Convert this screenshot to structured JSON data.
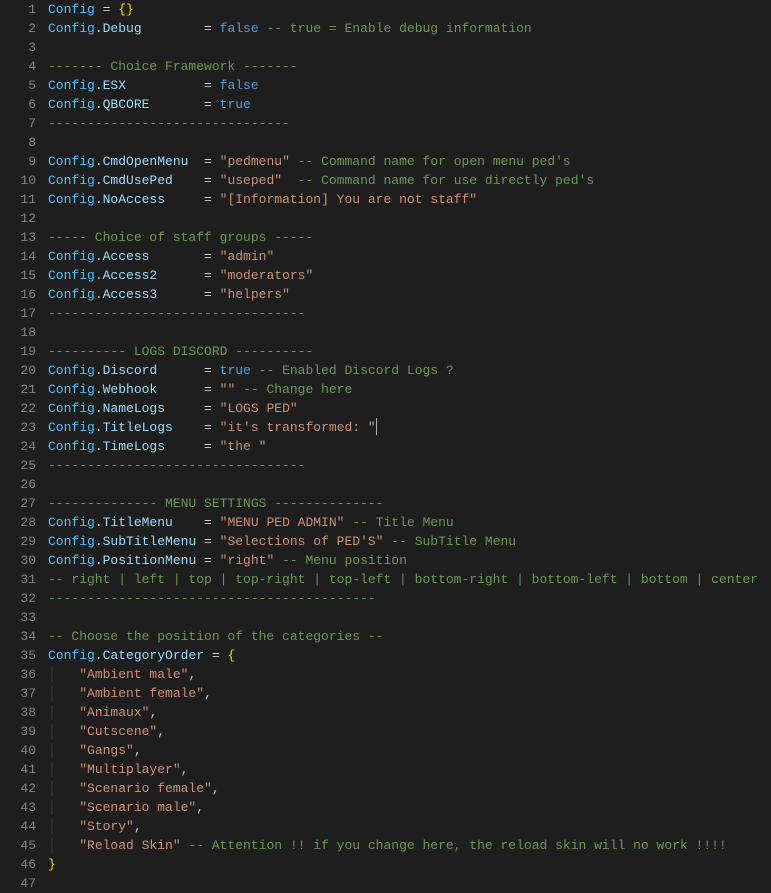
{
  "lines": [
    {
      "n": 1,
      "segs": [
        {
          "t": "Config",
          "c": "tok-obj"
        },
        {
          "t": " = ",
          "c": "tok-op"
        },
        {
          "t": "{}",
          "c": "tok-brace"
        }
      ]
    },
    {
      "n": 2,
      "segs": [
        {
          "t": "Config",
          "c": "tok-obj"
        },
        {
          "t": ".",
          "c": "tok-punc"
        },
        {
          "t": "Debug",
          "c": "tok-prop"
        },
        {
          "t": "        = ",
          "c": "tok-op"
        },
        {
          "t": "false",
          "c": "tok-bool"
        },
        {
          "t": " -- true = Enable debug information",
          "c": "tok-comment"
        }
      ]
    },
    {
      "n": 3,
      "segs": []
    },
    {
      "n": 4,
      "segs": [
        {
          "t": "------- Choice Framework -------",
          "c": "tok-comment"
        }
      ]
    },
    {
      "n": 5,
      "segs": [
        {
          "t": "Config",
          "c": "tok-obj"
        },
        {
          "t": ".",
          "c": "tok-punc"
        },
        {
          "t": "ESX",
          "c": "tok-prop"
        },
        {
          "t": "          = ",
          "c": "tok-op"
        },
        {
          "t": "false",
          "c": "tok-bool"
        }
      ]
    },
    {
      "n": 6,
      "segs": [
        {
          "t": "Config",
          "c": "tok-obj"
        },
        {
          "t": ".",
          "c": "tok-punc"
        },
        {
          "t": "QBCORE",
          "c": "tok-prop"
        },
        {
          "t": "       = ",
          "c": "tok-op"
        },
        {
          "t": "true",
          "c": "tok-bool"
        }
      ]
    },
    {
      "n": 7,
      "segs": [
        {
          "t": "-------------------------------",
          "c": "tok-comment"
        }
      ]
    },
    {
      "n": 8,
      "segs": []
    },
    {
      "n": 9,
      "segs": [
        {
          "t": "Config",
          "c": "tok-obj"
        },
        {
          "t": ".",
          "c": "tok-punc"
        },
        {
          "t": "CmdOpenMenu",
          "c": "tok-prop"
        },
        {
          "t": "  = ",
          "c": "tok-op"
        },
        {
          "t": "\"pedmenu\"",
          "c": "tok-str"
        },
        {
          "t": " -- Command name for open menu ped's",
          "c": "tok-comment"
        }
      ]
    },
    {
      "n": 10,
      "segs": [
        {
          "t": "Config",
          "c": "tok-obj"
        },
        {
          "t": ".",
          "c": "tok-punc"
        },
        {
          "t": "CmdUsePed",
          "c": "tok-prop"
        },
        {
          "t": "    = ",
          "c": "tok-op"
        },
        {
          "t": "\"useped\"",
          "c": "tok-str"
        },
        {
          "t": "  -- Command name for use directly ped's",
          "c": "tok-comment"
        }
      ]
    },
    {
      "n": 11,
      "segs": [
        {
          "t": "Config",
          "c": "tok-obj"
        },
        {
          "t": ".",
          "c": "tok-punc"
        },
        {
          "t": "NoAccess",
          "c": "tok-prop"
        },
        {
          "t": "     = ",
          "c": "tok-op"
        },
        {
          "t": "\"[Information] You are not staff\"",
          "c": "tok-str"
        }
      ]
    },
    {
      "n": 12,
      "segs": []
    },
    {
      "n": 13,
      "segs": [
        {
          "t": "----- Choice of staff groups -----",
          "c": "tok-comment"
        }
      ]
    },
    {
      "n": 14,
      "segs": [
        {
          "t": "Config",
          "c": "tok-obj"
        },
        {
          "t": ".",
          "c": "tok-punc"
        },
        {
          "t": "Access",
          "c": "tok-prop"
        },
        {
          "t": "       = ",
          "c": "tok-op"
        },
        {
          "t": "\"admin\"",
          "c": "tok-str"
        }
      ]
    },
    {
      "n": 15,
      "segs": [
        {
          "t": "Config",
          "c": "tok-obj"
        },
        {
          "t": ".",
          "c": "tok-punc"
        },
        {
          "t": "Access2",
          "c": "tok-prop"
        },
        {
          "t": "      = ",
          "c": "tok-op"
        },
        {
          "t": "\"moderators\"",
          "c": "tok-str"
        }
      ]
    },
    {
      "n": 16,
      "segs": [
        {
          "t": "Config",
          "c": "tok-obj"
        },
        {
          "t": ".",
          "c": "tok-punc"
        },
        {
          "t": "Access3",
          "c": "tok-prop"
        },
        {
          "t": "      = ",
          "c": "tok-op"
        },
        {
          "t": "\"helpers\"",
          "c": "tok-str"
        }
      ]
    },
    {
      "n": 17,
      "segs": [
        {
          "t": "---------------------------------",
          "c": "tok-comment"
        }
      ]
    },
    {
      "n": 18,
      "segs": []
    },
    {
      "n": 19,
      "segs": [
        {
          "t": "---------- LOGS DISCORD ----------",
          "c": "tok-comment"
        }
      ]
    },
    {
      "n": 20,
      "segs": [
        {
          "t": "Config",
          "c": "tok-obj"
        },
        {
          "t": ".",
          "c": "tok-punc"
        },
        {
          "t": "Discord",
          "c": "tok-prop"
        },
        {
          "t": "      = ",
          "c": "tok-op"
        },
        {
          "t": "true",
          "c": "tok-bool"
        },
        {
          "t": " -- Enabled Discord Logs ?",
          "c": "tok-comment"
        }
      ]
    },
    {
      "n": 21,
      "segs": [
        {
          "t": "Config",
          "c": "tok-obj"
        },
        {
          "t": ".",
          "c": "tok-punc"
        },
        {
          "t": "Webhook",
          "c": "tok-prop"
        },
        {
          "t": "      = ",
          "c": "tok-op"
        },
        {
          "t": "\"\"",
          "c": "tok-str"
        },
        {
          "t": " -- Change here",
          "c": "tok-comment"
        }
      ]
    },
    {
      "n": 22,
      "segs": [
        {
          "t": "Config",
          "c": "tok-obj"
        },
        {
          "t": ".",
          "c": "tok-punc"
        },
        {
          "t": "NameLogs",
          "c": "tok-prop"
        },
        {
          "t": "     = ",
          "c": "tok-op"
        },
        {
          "t": "\"LOGS PED\"",
          "c": "tok-str"
        }
      ]
    },
    {
      "n": 23,
      "segs": [
        {
          "t": "Config",
          "c": "tok-obj"
        },
        {
          "t": ".",
          "c": "tok-punc"
        },
        {
          "t": "TitleLogs",
          "c": "tok-prop"
        },
        {
          "t": "    = ",
          "c": "tok-op"
        },
        {
          "t": "\"it's transformed: \"",
          "c": "tok-str"
        }
      ],
      "cursor": true
    },
    {
      "n": 24,
      "segs": [
        {
          "t": "Config",
          "c": "tok-obj"
        },
        {
          "t": ".",
          "c": "tok-punc"
        },
        {
          "t": "TimeLogs",
          "c": "tok-prop"
        },
        {
          "t": "     = ",
          "c": "tok-op"
        },
        {
          "t": "\"the \"",
          "c": "tok-str"
        }
      ]
    },
    {
      "n": 25,
      "segs": [
        {
          "t": "---------------------------------",
          "c": "tok-comment"
        }
      ]
    },
    {
      "n": 26,
      "segs": []
    },
    {
      "n": 27,
      "segs": [
        {
          "t": "-------------- MENU SETTINGS --------------",
          "c": "tok-comment"
        }
      ]
    },
    {
      "n": 28,
      "segs": [
        {
          "t": "Config",
          "c": "tok-obj"
        },
        {
          "t": ".",
          "c": "tok-punc"
        },
        {
          "t": "TitleMenu",
          "c": "tok-prop"
        },
        {
          "t": "    = ",
          "c": "tok-op"
        },
        {
          "t": "\"MENU PED ADMIN\"",
          "c": "tok-str"
        },
        {
          "t": " -- Title Menu",
          "c": "tok-comment"
        }
      ]
    },
    {
      "n": 29,
      "segs": [
        {
          "t": "Config",
          "c": "tok-obj"
        },
        {
          "t": ".",
          "c": "tok-punc"
        },
        {
          "t": "SubTitleMenu",
          "c": "tok-prop"
        },
        {
          "t": " = ",
          "c": "tok-op"
        },
        {
          "t": "\"Selections of PED'S\"",
          "c": "tok-str"
        },
        {
          "t": " -- SubTitle Menu",
          "c": "tok-comment"
        }
      ]
    },
    {
      "n": 30,
      "segs": [
        {
          "t": "Config",
          "c": "tok-obj"
        },
        {
          "t": ".",
          "c": "tok-punc"
        },
        {
          "t": "PositionMenu",
          "c": "tok-prop"
        },
        {
          "t": " = ",
          "c": "tok-op"
        },
        {
          "t": "\"right\"",
          "c": "tok-str"
        },
        {
          "t": " -- Menu position",
          "c": "tok-comment"
        }
      ]
    },
    {
      "n": 31,
      "segs": [
        {
          "t": "-- right | left | top | top-right | top-left | bottom-right | bottom-left | bottom | center",
          "c": "tok-comment"
        }
      ]
    },
    {
      "n": 32,
      "segs": [
        {
          "t": "------------------------------------------",
          "c": "tok-comment"
        }
      ]
    },
    {
      "n": 33,
      "segs": []
    },
    {
      "n": 34,
      "segs": [
        {
          "t": "-- Choose the position of the categories --",
          "c": "tok-comment"
        }
      ]
    },
    {
      "n": 35,
      "segs": [
        {
          "t": "Config",
          "c": "tok-obj"
        },
        {
          "t": ".",
          "c": "tok-punc"
        },
        {
          "t": "CategoryOrder",
          "c": "tok-prop"
        },
        {
          "t": " = ",
          "c": "tok-op"
        },
        {
          "t": "{",
          "c": "tok-brace"
        }
      ]
    },
    {
      "n": 36,
      "indent": true,
      "segs": [
        {
          "t": "    ",
          "c": ""
        },
        {
          "t": "\"Ambient male\"",
          "c": "tok-str"
        },
        {
          "t": ",",
          "c": "tok-punc"
        }
      ]
    },
    {
      "n": 37,
      "indent": true,
      "segs": [
        {
          "t": "    ",
          "c": ""
        },
        {
          "t": "\"Ambient female\"",
          "c": "tok-str"
        },
        {
          "t": ",",
          "c": "tok-punc"
        }
      ]
    },
    {
      "n": 38,
      "indent": true,
      "segs": [
        {
          "t": "    ",
          "c": ""
        },
        {
          "t": "\"Animaux\"",
          "c": "tok-str"
        },
        {
          "t": ",",
          "c": "tok-punc"
        }
      ]
    },
    {
      "n": 39,
      "indent": true,
      "segs": [
        {
          "t": "    ",
          "c": ""
        },
        {
          "t": "\"Cutscene\"",
          "c": "tok-str"
        },
        {
          "t": ",",
          "c": "tok-punc"
        }
      ]
    },
    {
      "n": 40,
      "indent": true,
      "segs": [
        {
          "t": "    ",
          "c": ""
        },
        {
          "t": "\"Gangs\"",
          "c": "tok-str"
        },
        {
          "t": ",",
          "c": "tok-punc"
        }
      ]
    },
    {
      "n": 41,
      "indent": true,
      "segs": [
        {
          "t": "    ",
          "c": ""
        },
        {
          "t": "\"Multiplayer\"",
          "c": "tok-str"
        },
        {
          "t": ",",
          "c": "tok-punc"
        }
      ]
    },
    {
      "n": 42,
      "indent": true,
      "segs": [
        {
          "t": "    ",
          "c": ""
        },
        {
          "t": "\"Scenario female\"",
          "c": "tok-str"
        },
        {
          "t": ",",
          "c": "tok-punc"
        }
      ]
    },
    {
      "n": 43,
      "indent": true,
      "segs": [
        {
          "t": "    ",
          "c": ""
        },
        {
          "t": "\"Scenario male\"",
          "c": "tok-str"
        },
        {
          "t": ",",
          "c": "tok-punc"
        }
      ]
    },
    {
      "n": 44,
      "indent": true,
      "segs": [
        {
          "t": "    ",
          "c": ""
        },
        {
          "t": "\"Story\"",
          "c": "tok-str"
        },
        {
          "t": ",",
          "c": "tok-punc"
        }
      ]
    },
    {
      "n": 45,
      "indent": true,
      "segs": [
        {
          "t": "    ",
          "c": ""
        },
        {
          "t": "\"Reload Skin\"",
          "c": "tok-str"
        },
        {
          "t": " -- Attention !! if you change here, the reload skin will no work !!!!",
          "c": "tok-comment"
        }
      ]
    },
    {
      "n": 46,
      "segs": [
        {
          "t": "}",
          "c": "tok-brace"
        }
      ]
    },
    {
      "n": 47,
      "segs": []
    }
  ]
}
